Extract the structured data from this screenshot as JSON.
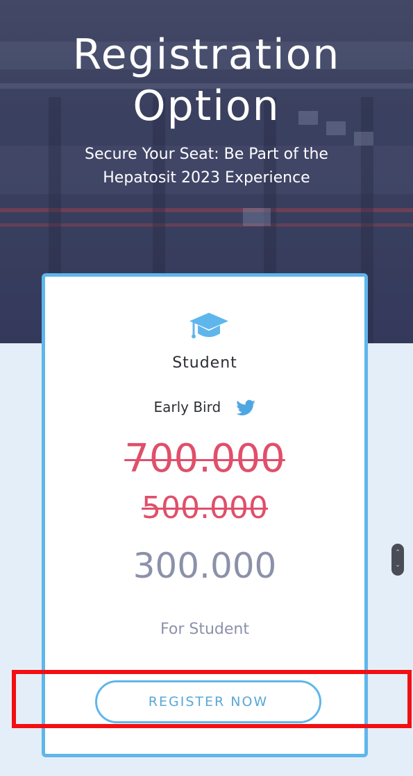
{
  "hero": {
    "title_line1": "Registration",
    "title_line2": "Option",
    "subtitle_line1": "Secure Your Seat: Be Part of the",
    "subtitle_line2": "Hepatosit 2023 Experience"
  },
  "card": {
    "icon": "graduation-cap-icon",
    "plan_name": "Student",
    "early_label": "Early Bird",
    "early_icon": "twitter-bird-icon",
    "price_original": "700.000",
    "price_discount1": "500.000",
    "price_current": "300.000",
    "note": "For Student",
    "button_label": "REGISTER NOW"
  },
  "colors": {
    "accent": "#5fb6ec",
    "strike_red": "#e04f6a",
    "muted": "#8c91aa",
    "highlight": "#f20f12"
  }
}
